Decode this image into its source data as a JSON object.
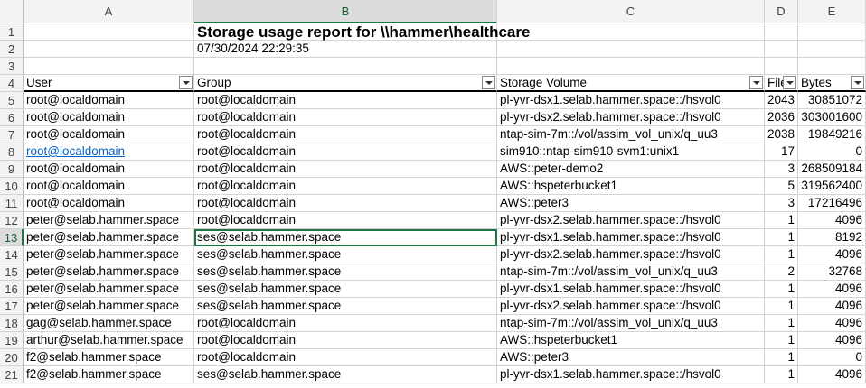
{
  "columns": [
    "A",
    "B",
    "C",
    "D",
    "E"
  ],
  "selected_column": "B",
  "selected_row": 13,
  "report": {
    "title": "Storage usage report for \\\\hammer\\healthcare",
    "timestamp": "07/30/2024 22:29:35"
  },
  "table": {
    "headers": [
      "User",
      "Group",
      "Storage Volume",
      "Files",
      "Bytes"
    ],
    "rows": [
      {
        "row": 5,
        "user": "root@localdomain",
        "group": "root@localdomain",
        "volume": "pl-yvr-dsx1.selab.hammer.space::/hsvol0",
        "files": "2043",
        "bytes": "30851072"
      },
      {
        "row": 6,
        "user": "root@localdomain",
        "group": "root@localdomain",
        "volume": "pl-yvr-dsx2.selab.hammer.space::/hsvol0",
        "files": "2036",
        "bytes": "303001600"
      },
      {
        "row": 7,
        "user": "root@localdomain",
        "group": "root@localdomain",
        "volume": "ntap-sim-7m::/vol/assim_vol_unix/q_uu3",
        "files": "2038",
        "bytes": "19849216"
      },
      {
        "row": 8,
        "user": "root@localdomain",
        "group": "root@localdomain",
        "volume": "sim910::ntap-sim910-svm1:unix1",
        "files": "17",
        "bytes": "0",
        "link": true
      },
      {
        "row": 9,
        "user": "root@localdomain",
        "group": "root@localdomain",
        "volume": "AWS::peter-demo2",
        "files": "3",
        "bytes": "268509184"
      },
      {
        "row": 10,
        "user": "root@localdomain",
        "group": "root@localdomain",
        "volume": "AWS::hspeterbucket1",
        "files": "5",
        "bytes": "319562400"
      },
      {
        "row": 11,
        "user": "root@localdomain",
        "group": "root@localdomain",
        "volume": "AWS::peter3",
        "files": "3",
        "bytes": "17216496"
      },
      {
        "row": 12,
        "user": "peter@selab.hammer.space",
        "group": "root@localdomain",
        "volume": "pl-yvr-dsx2.selab.hammer.space::/hsvol0",
        "files": "1",
        "bytes": "4096"
      },
      {
        "row": 13,
        "user": "peter@selab.hammer.space",
        "group": "ses@selab.hammer.space",
        "volume": "pl-yvr-dsx1.selab.hammer.space::/hsvol0",
        "files": "1",
        "bytes": "8192"
      },
      {
        "row": 14,
        "user": "peter@selab.hammer.space",
        "group": "ses@selab.hammer.space",
        "volume": "pl-yvr-dsx2.selab.hammer.space::/hsvol0",
        "files": "1",
        "bytes": "4096"
      },
      {
        "row": 15,
        "user": "peter@selab.hammer.space",
        "group": "ses@selab.hammer.space",
        "volume": "ntap-sim-7m::/vol/assim_vol_unix/q_uu3",
        "files": "2",
        "bytes": "32768"
      },
      {
        "row": 16,
        "user": "peter@selab.hammer.space",
        "group": "ses@selab.hammer.space",
        "volume": "pl-yvr-dsx1.selab.hammer.space::/hsvol0",
        "files": "1",
        "bytes": "4096"
      },
      {
        "row": 17,
        "user": "peter@selab.hammer.space",
        "group": "ses@selab.hammer.space",
        "volume": "pl-yvr-dsx2.selab.hammer.space::/hsvol0",
        "files": "1",
        "bytes": "4096"
      },
      {
        "row": 18,
        "user": "gag@selab.hammer.space",
        "group": "root@localdomain",
        "volume": "ntap-sim-7m::/vol/assim_vol_unix/q_uu3",
        "files": "1",
        "bytes": "4096"
      },
      {
        "row": 19,
        "user": "arthur@selab.hammer.space",
        "group": "root@localdomain",
        "volume": "AWS::hspeterbucket1",
        "files": "1",
        "bytes": "4096"
      },
      {
        "row": 20,
        "user": "f2@selab.hammer.space",
        "group": "root@localdomain",
        "volume": "AWS::peter3",
        "files": "1",
        "bytes": "0"
      },
      {
        "row": 21,
        "user": "f2@selab.hammer.space",
        "group": "ses@selab.hammer.space",
        "volume": "pl-yvr-dsx1.selab.hammer.space::/hsvol0",
        "files": "1",
        "bytes": "4096"
      }
    ]
  },
  "colors": {
    "accent": "#217346",
    "link": "#0563c1",
    "header_bg": "#f3f3f3",
    "gridline": "#d4d4d4"
  },
  "icons": {
    "filter": "filter-dropdown-icon"
  }
}
